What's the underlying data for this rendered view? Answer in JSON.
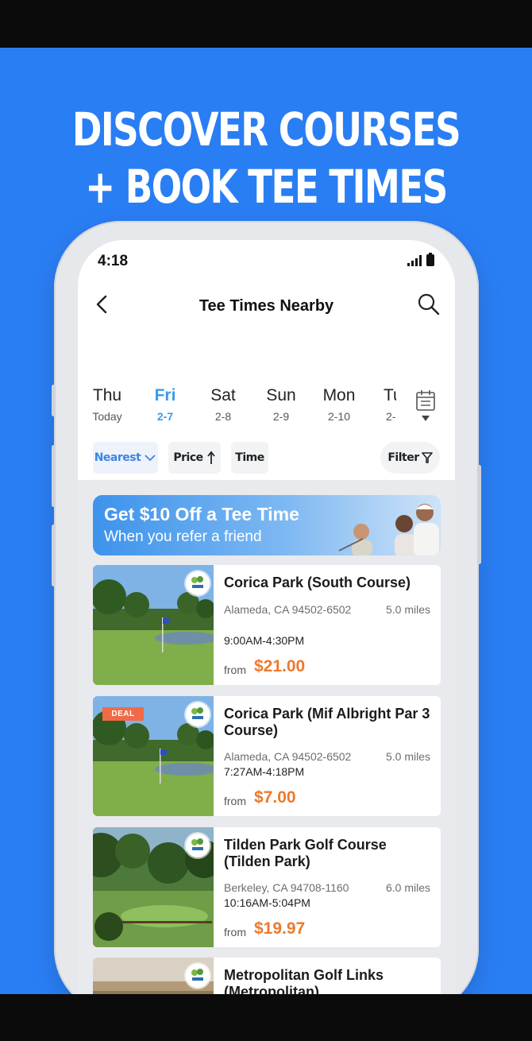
{
  "headline": {
    "line1": "DISCOVER COURSES",
    "line2": "+ BOOK TEE TIMES"
  },
  "status_bar": {
    "time": "4:18"
  },
  "nav": {
    "title": "Tee Times Nearby"
  },
  "dates": [
    {
      "day": "Thu",
      "date": "Today",
      "active": false
    },
    {
      "day": "Fri",
      "date": "2-7",
      "active": true
    },
    {
      "day": "Sat",
      "date": "2-8",
      "active": false
    },
    {
      "day": "Sun",
      "date": "2-9",
      "active": false
    },
    {
      "day": "Mon",
      "date": "2-10",
      "active": false
    },
    {
      "day": "Tu",
      "date": "2-",
      "active": false
    }
  ],
  "sort": {
    "nearest": "Nearest",
    "price": "Price",
    "time": "Time",
    "filter": "Filter"
  },
  "promo": {
    "title": "Get $10 Off a Tee Time",
    "subtitle": "When you refer a friend"
  },
  "courses": [
    {
      "name": "Corica Park (South Course)",
      "address": "Alameda, CA 94502-6502",
      "distance": "5.0 miles",
      "hours": "9:00AM-4:30PM",
      "from_label": "from",
      "price": "$21.00",
      "deal": false
    },
    {
      "name": "Corica Park (Mif Albright Par 3 Course)",
      "address": "Alameda, CA 94502-6502",
      "distance": "5.0 miles",
      "hours": "7:27AM-4:18PM",
      "from_label": "from",
      "price": "$7.00",
      "deal": true,
      "deal_label": "DEAL"
    },
    {
      "name": "Tilden Park Golf Course (Tilden Park)",
      "address": "Berkeley, CA 94708-1160",
      "distance": "6.0 miles",
      "hours": "10:16AM-5:04PM",
      "from_label": "from",
      "price": "$19.97",
      "deal": false
    },
    {
      "name": "Metropolitan Golf Links (Metropolitan)",
      "address": "",
      "distance": "",
      "hours": "",
      "from_label": "",
      "price": "",
      "deal": false
    }
  ],
  "colors": {
    "background": "#2a7ef4",
    "accent": "#3c9be8",
    "price": "#ec7a2c",
    "deal": "#f06a48"
  }
}
